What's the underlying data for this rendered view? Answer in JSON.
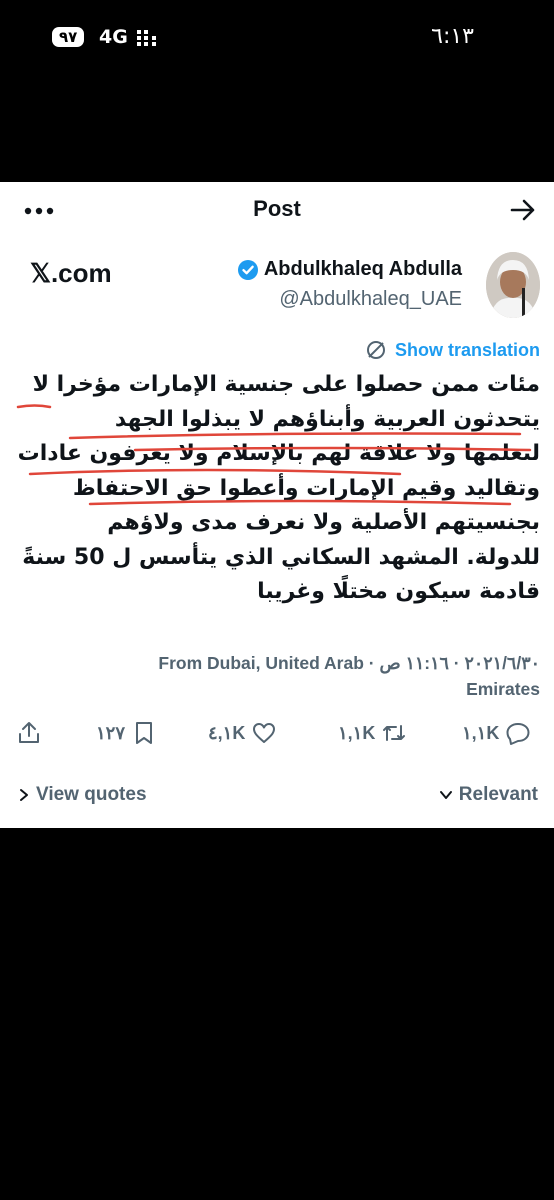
{
  "status_bar": {
    "time": "٦:١٣",
    "battery": "٩٧",
    "network": "4G"
  },
  "header": {
    "title": "Post"
  },
  "watermark": "𝕏.com",
  "author": {
    "name": "Abdulkhaleq Abdulla",
    "handle": "@Abdulkhaleq_UAE"
  },
  "show_translation": "Show translation",
  "tweet_lines": [
    "مئات ممن حصلوا على جنسية الإمارات مؤخرا لا",
    "يتحدثون العربية وأبناؤهم لا يبذلوا الجهد",
    "لتعلمها ولا علاقة لهم بالإسلام ولا يعرفون عادات",
    "وتقاليد وقيم الإمارات وأعطوا حق الاحتفاظ",
    "بجنسيتهم الأصلية ولا نعرف مدى ولاؤهم",
    "للدولة. المشهد السكاني الذي يتأسس ل 50 سنةً",
    "قادمة سيكون مختلًا وغريبا"
  ],
  "meta": {
    "line1": "٢٠٢١/٦/٣٠ · ١١:١٦ ص · From Dubai, United Arab",
    "line2": "Emirates"
  },
  "actions": {
    "replies": "١,١K",
    "reposts": "١,١K",
    "likes": "٤,١K",
    "bookmarks": "١٢٧"
  },
  "footer": {
    "view_quotes": "View quotes",
    "relevant": "Relevant"
  },
  "colors": {
    "accent": "#1d9bf0",
    "muted": "#536471",
    "annotation": "#e0463a"
  }
}
